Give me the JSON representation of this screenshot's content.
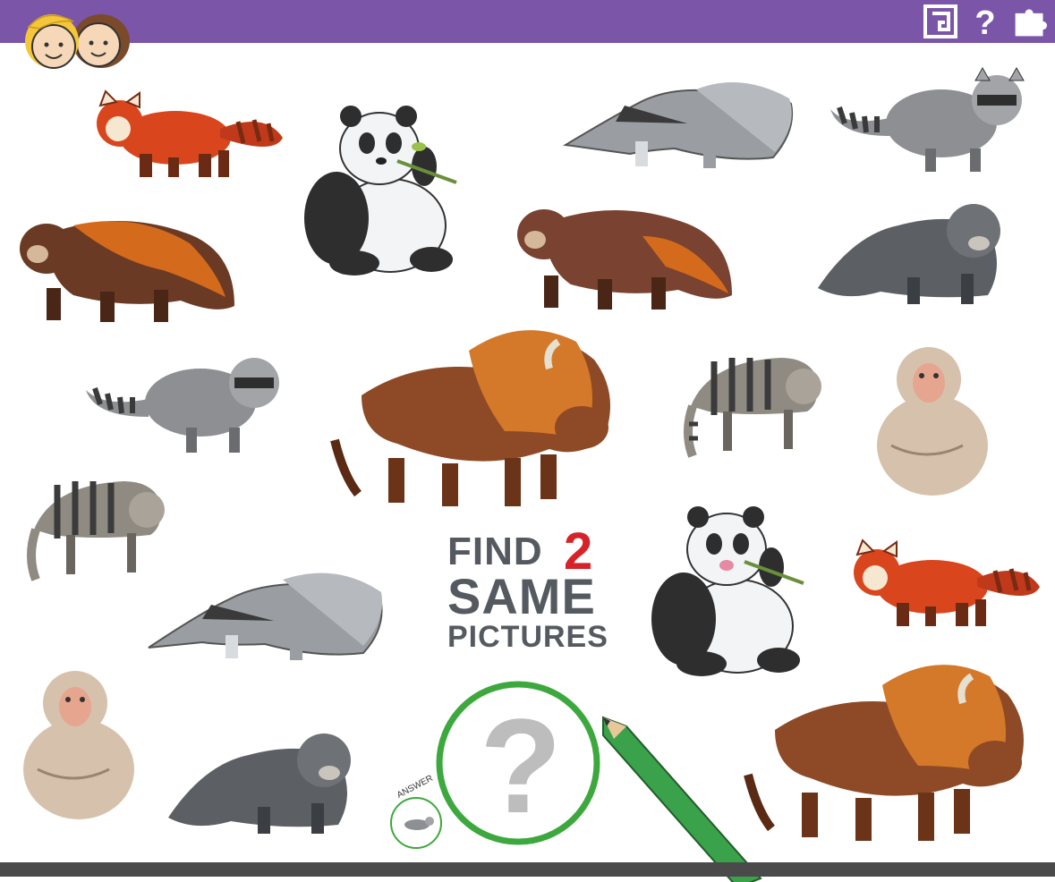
{
  "title": {
    "line1": "FIND",
    "number": "2",
    "line2": "SAME",
    "line3": "PICTURES"
  },
  "answer_label": "ANSWER",
  "question_mark": "?",
  "toolbar": {
    "icons": [
      "maze-icon",
      "question-icon",
      "puzzle-icon"
    ],
    "question_glyph": "?"
  },
  "colors": {
    "header": "#7b55a8",
    "footer": "#4a4a4a",
    "title_text": "#555a60",
    "title_number": "#d6232a",
    "magnifier_ring": "#3da83d",
    "pencil": "#3aa24a"
  },
  "animals": [
    "red-panda",
    "panda",
    "anteater",
    "raccoon",
    "wolverine",
    "wolverine",
    "binturong",
    "raccoon",
    "bison",
    "civet",
    "macaque",
    "civet",
    "anteater",
    "panda",
    "red-panda",
    "macaque",
    "binturong",
    "bison"
  ]
}
